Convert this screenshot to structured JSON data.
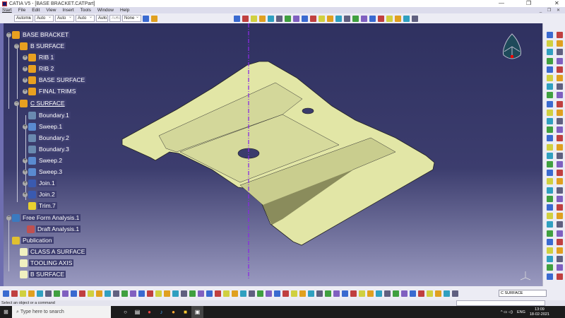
{
  "window": {
    "title": "CATIA V5 - [BASE BRACKET.CATPart]",
    "minimize": "—",
    "restore": "❐",
    "close": "✕"
  },
  "menu": [
    "Start",
    "File",
    "Edit",
    "View",
    "Insert",
    "Tools",
    "Window",
    "Help"
  ],
  "graphic_toolbar": {
    "combos": [
      "Automa",
      "Auto",
      "Auto",
      "Auto",
      "Auto",
      "Auto",
      "None"
    ],
    "disabled_index": 5
  },
  "tree": {
    "root": "BASE BRACKET",
    "b_surface": "B SURFACE",
    "b_children": [
      "RIB 1",
      "RIB 2",
      "BASE SURFACE",
      "FINAL TRIMS"
    ],
    "c_surface": "C SURFACE",
    "c_children": [
      "Boundary.1",
      "Sweep.1",
      "Boundary.2",
      "Boundary.3",
      "Sweep.2",
      "Sweep.3",
      "Join.1",
      "Join.2",
      "Trim.7"
    ],
    "analysis": "Free Form Analysis.1",
    "draft": "Draft Analysis.1",
    "publication": "Publication",
    "pub_children": [
      "CLASS A SURFACE",
      "TOOLING AXIS",
      "B SURFACE"
    ]
  },
  "colors": {
    "model": "#e2e6a6",
    "axis": "#8a2be2",
    "bg_top": "#2f3160",
    "bg_bottom": "#9a9ac0"
  },
  "bottom_toolbar": {
    "current_body": "C SURFACE"
  },
  "status": {
    "message": "Select an object or a command"
  },
  "taskbar": {
    "search_placeholder": "Type here to search",
    "lang": "ENG",
    "time": "13:09",
    "date": "18-02-2021"
  }
}
